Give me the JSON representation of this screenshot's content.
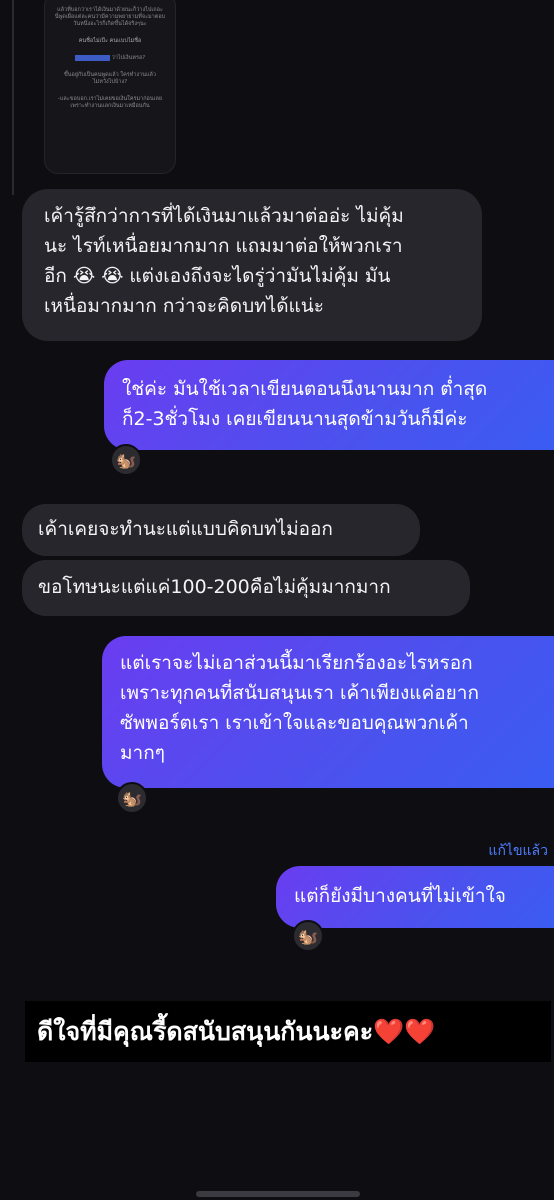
{
  "thread": {
    "forwarded_preview": {
      "line1": "แล้วที่บอกว่าเราได้เงินมาด้วยนะก็ว่างไปเถอะ\nนี่พูดเผื่อแต่ละคนว่ามีความพยายามที่จะมาตอบ\nวันหนึ่งอะไรก็เกิดขึ้นได้จริงๆนะ",
      "line2": "คนชื่อไม่เป๊ะ คนเเบบไม่ชื่อ",
      "line3_suffix": "ว่าไปเงินหรอ?",
      "line4": "ขึ้นอยู่กับเป็นคนพูดแล้ว ใครทำงานแล้ว\nไม่หวังไปบ้าง?",
      "line5": "-และขอบอก.เราไม่เคยขอเงินใครมาก่อนเลย\nเพราะทำงานแลกเงินมาเหมือนกัน"
    },
    "messages": [
      {
        "dir": "in",
        "text": "เค้ารู้สึกว่าการที่ได้เงินมาแล้วมาต่ออ่ะ ไม่คุ้ม\nนะ ไรท์เหนื่อยมากมาก แถมมาต่อให้พวกเรา\nอีก 😭 😭  แต่งเองถึงจะไดรู่ว่ามันไม่คุ้ม มัน\nเหนื่อมากมาก กว่าจะคิดบทได้แน่ะ"
      },
      {
        "dir": "out",
        "text": "ใช่ค่ะ มันใช้เวลาเขียนตอนนึงนานมาก ต่ำสุด\nก็2-3ชั่วโมง เคยเขียนนานสุดข้ามวันก็มีค่ะ"
      },
      {
        "dir": "in",
        "text": "เค้าเคยจะทำนะแต่แบบคิดบทไม่ออก"
      },
      {
        "dir": "in",
        "text": "ขอโทษนะแต่แค่100-200คือไม่คุ้มมากมาก"
      },
      {
        "dir": "out",
        "text": "แต่เราจะไม่เอาส่วนนี้มาเรียกร้องอะไรหรอก\nเพราะทุกคนที่สนับสนุนเรา เค้าเพียงแค่อยาก\nซัพพอร์ตเรา เราเข้าใจและขอบคุณพวกเค้า\nมากๆ"
      },
      {
        "dir": "out",
        "text": "แต่ก็ยังมีบางคนที่ไม่เข้าใจ"
      }
    ],
    "edited_label": "แก้ไขแล้ว",
    "reaction_emoji": "🐿️"
  },
  "caption": "ดีใจที่มีคุณรี้ดสนับสนุนกันนะคะ❤️❤️",
  "colors": {
    "background": "#0e0e12",
    "incoming_bubble": "#26262c",
    "outgoing_gradient_start": "#6a3df0",
    "outgoing_gradient_end": "#3a5cf2",
    "edited_label": "#4d7cff"
  }
}
